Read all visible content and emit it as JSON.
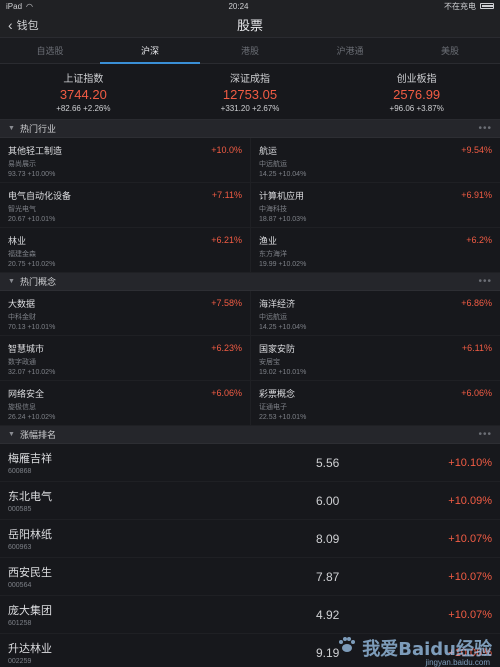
{
  "status_bar": {
    "device": "iPad",
    "time": "20:24",
    "charge": "不在充电"
  },
  "nav": {
    "back_label": "钱包",
    "title": "股票"
  },
  "tabs": [
    {
      "label": "自选股",
      "active": false
    },
    {
      "label": "沪深",
      "active": true
    },
    {
      "label": "港股",
      "active": false
    },
    {
      "label": "沪港通",
      "active": false
    },
    {
      "label": "美股",
      "active": false
    }
  ],
  "indices": [
    {
      "name": "上证指数",
      "value": "3744.20",
      "change": "+82.66  +2.26%"
    },
    {
      "name": "深证成指",
      "value": "12753.05",
      "change": "+331.20  +2.67%"
    },
    {
      "name": "创业板指",
      "value": "2576.99",
      "change": "+96.06  +3.87%"
    }
  ],
  "hot_industry": {
    "title": "热门行业",
    "more": "•••",
    "items": [
      {
        "name": "其他轻工制造",
        "pct": "+10.0%",
        "leader": "易尚展示",
        "leader_stat": "93.73  +10.00%"
      },
      {
        "name": "航运",
        "pct": "+9.54%",
        "leader": "中远航运",
        "leader_stat": "14.25  +10.04%"
      },
      {
        "name": "电气自动化设备",
        "pct": "+7.11%",
        "leader": "智光电气",
        "leader_stat": "20.67  +10.01%"
      },
      {
        "name": "计算机应用",
        "pct": "+6.91%",
        "leader": "中海科技",
        "leader_stat": "18.87  +10.03%"
      },
      {
        "name": "林业",
        "pct": "+6.21%",
        "leader": "福建金森",
        "leader_stat": "20.75  +10.02%"
      },
      {
        "name": "渔业",
        "pct": "+6.2%",
        "leader": "东方海洋",
        "leader_stat": "19.99  +10.02%"
      }
    ]
  },
  "hot_concept": {
    "title": "热门概念",
    "more": "•••",
    "items": [
      {
        "name": "大数据",
        "pct": "+7.58%",
        "leader": "中科金财",
        "leader_stat": "70.13  +10.01%"
      },
      {
        "name": "海洋经济",
        "pct": "+6.86%",
        "leader": "中远航运",
        "leader_stat": "14.25  +10.04%"
      },
      {
        "name": "智慧城市",
        "pct": "+6.23%",
        "leader": "数字政通",
        "leader_stat": "32.07  +10.02%"
      },
      {
        "name": "国家安防",
        "pct": "+6.11%",
        "leader": "安居宝",
        "leader_stat": "19.02  +10.01%"
      },
      {
        "name": "网络安全",
        "pct": "+6.06%",
        "leader": "旋极信息",
        "leader_stat": "26.24  +10.02%"
      },
      {
        "name": "彩票概念",
        "pct": "+6.06%",
        "leader": "证通电子",
        "leader_stat": "22.53  +10.01%"
      }
    ]
  },
  "gainers": {
    "title": "涨幅排名",
    "more": "•••",
    "rows": [
      {
        "name": "梅雁吉祥",
        "code": "600868",
        "price": "5.56",
        "pct": "+10.10%"
      },
      {
        "name": "东北电气",
        "code": "000585",
        "price": "6.00",
        "pct": "+10.09%"
      },
      {
        "name": "岳阳林纸",
        "code": "600963",
        "price": "8.09",
        "pct": "+10.07%"
      },
      {
        "name": "西安民生",
        "code": "000564",
        "price": "7.87",
        "pct": "+10.07%"
      },
      {
        "name": "庞大集团",
        "code": "601258",
        "price": "4.92",
        "pct": "+10.07%"
      },
      {
        "name": "升达林业",
        "code": "002259",
        "price": "9.19",
        "pct": "+10.06%"
      }
    ]
  },
  "watermark": {
    "text": "我爱Baidu经验",
    "url": "jingyan.baidu.com"
  },
  "colors": {
    "up": "#f25c44",
    "accent": "#3a8fd6",
    "background": "#17181c"
  }
}
